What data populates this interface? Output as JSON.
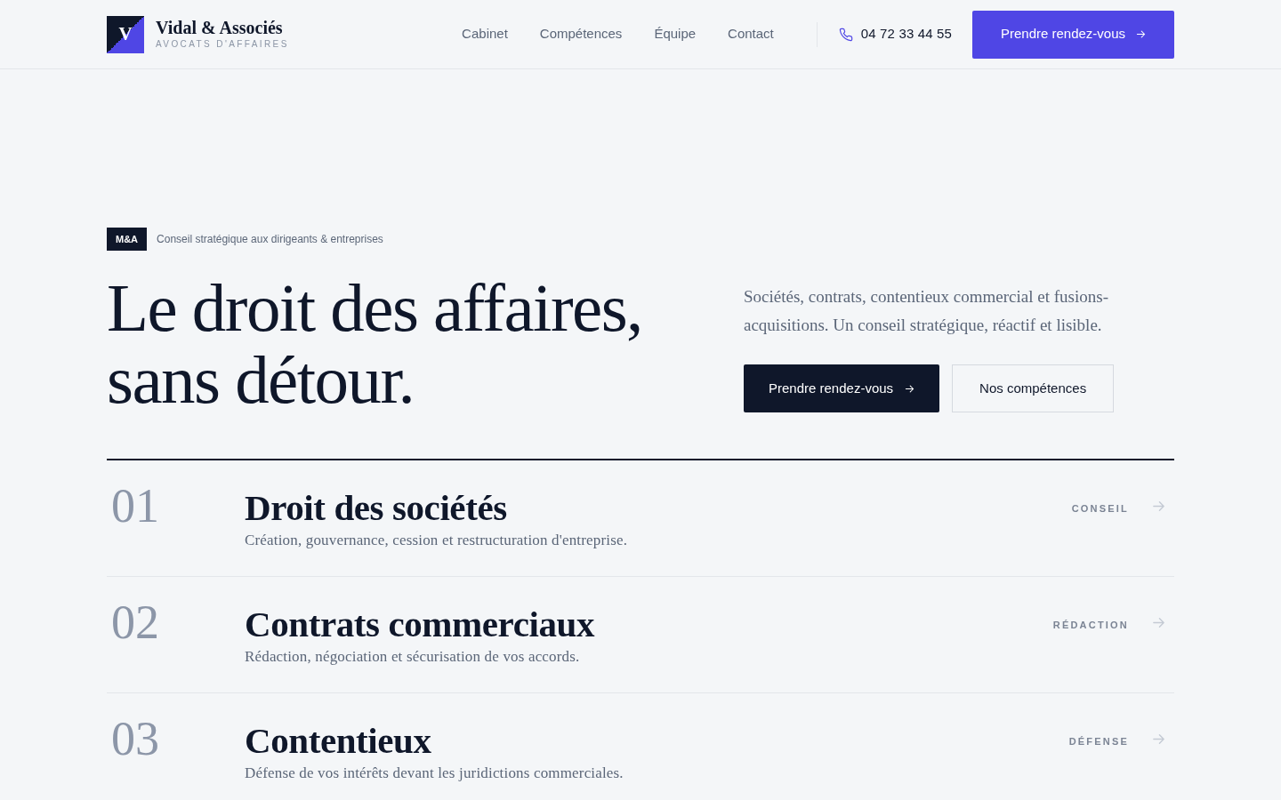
{
  "header": {
    "brand": {
      "monogram": "V",
      "name": "Vidal & Associés",
      "tagline": "AVOCATS D'AFFAIRES"
    },
    "nav": [
      {
        "label": "Cabinet"
      },
      {
        "label": "Compétences"
      },
      {
        "label": "Équipe"
      },
      {
        "label": "Contact"
      }
    ],
    "phone": "04 72 33 44 55",
    "cta": {
      "label": "Prendre rendez-vous"
    }
  },
  "hero": {
    "badge": "M&A",
    "eyebrow": "Conseil stratégique aux dirigeants & entreprises",
    "heading_lines": [
      "Le droit des affaires,",
      "sans détour."
    ],
    "intro": "Sociétés, contrats, contentieux commercial et fusions-acquisitions. Un conseil stratégique, réactif et lisible.",
    "buttons": [
      {
        "kind": "primary",
        "label": "Prendre rendez-vous"
      },
      {
        "kind": "secondary",
        "label": "Nos compétences"
      }
    ]
  },
  "practice_areas": [
    {
      "number": "01",
      "title": "Droit des sociétés",
      "description": "Création, gouvernance, cession et restructuration d'entreprise.",
      "tag": "CONSEIL"
    },
    {
      "number": "02",
      "title": "Contrats commerciaux",
      "description": "Rédaction, négociation et sécurisation de vos accords.",
      "tag": "RÉDACTION"
    },
    {
      "number": "03",
      "title": "Contentieux",
      "description": "Défense de vos intérêts devant les juridictions commerciales.",
      "tag": "DÉFENSE"
    }
  ]
}
